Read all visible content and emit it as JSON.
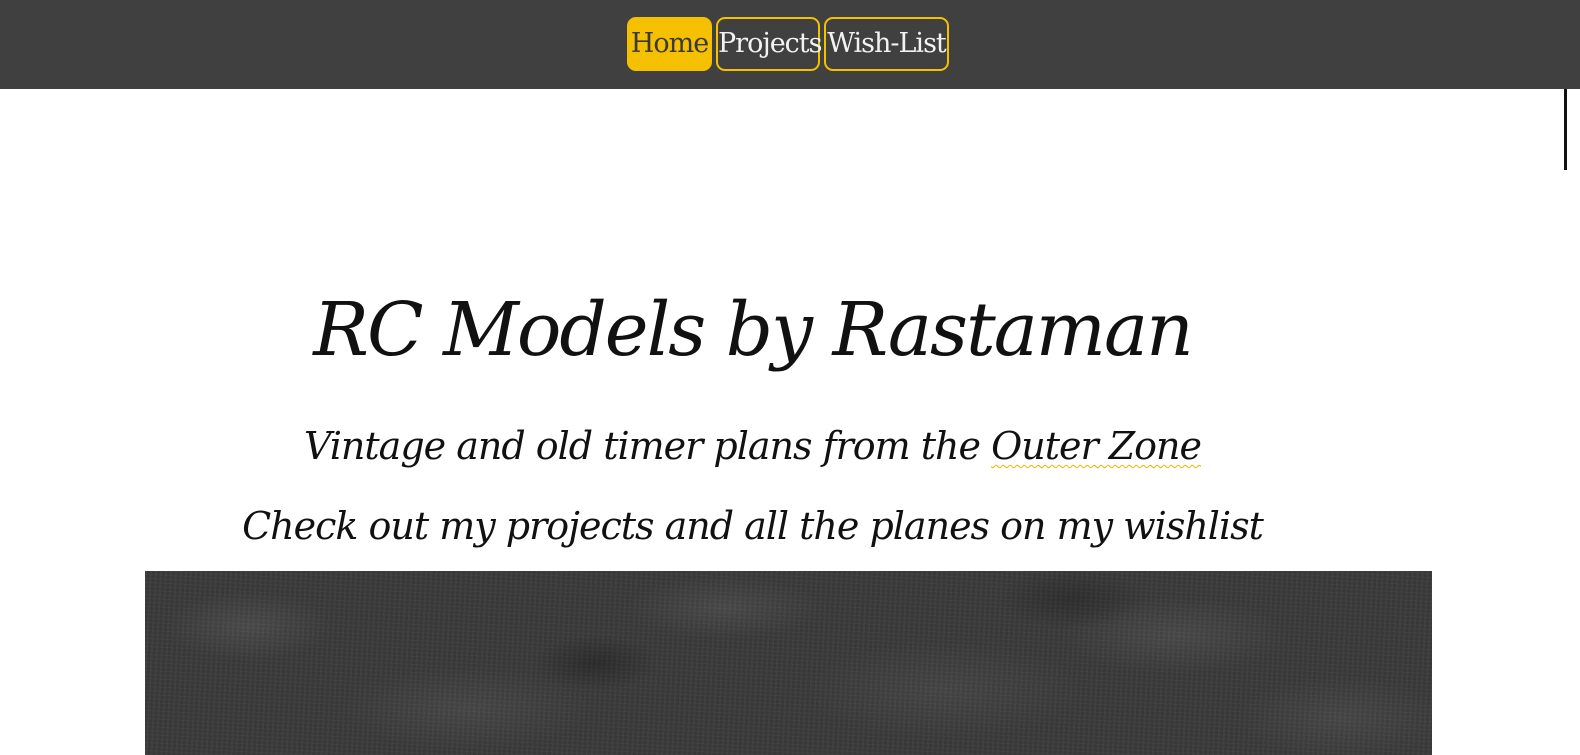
{
  "nav": {
    "items": [
      {
        "label": "Home",
        "active": true
      },
      {
        "label": "Projects",
        "active": false
      },
      {
        "label": "Wish-List",
        "active": false
      }
    ],
    "accent_color": "#f5c000",
    "bar_color": "#404040"
  },
  "hero": {
    "title": "RC Models by Rastaman",
    "subtitle_prefix": "Vintage and old timer plans from the ",
    "subtitle_link": "Outer Zone",
    "tagline": "Check out my projects and all the planes on my wishlist"
  },
  "banner": {
    "image_description_icon": "grass-photo"
  }
}
